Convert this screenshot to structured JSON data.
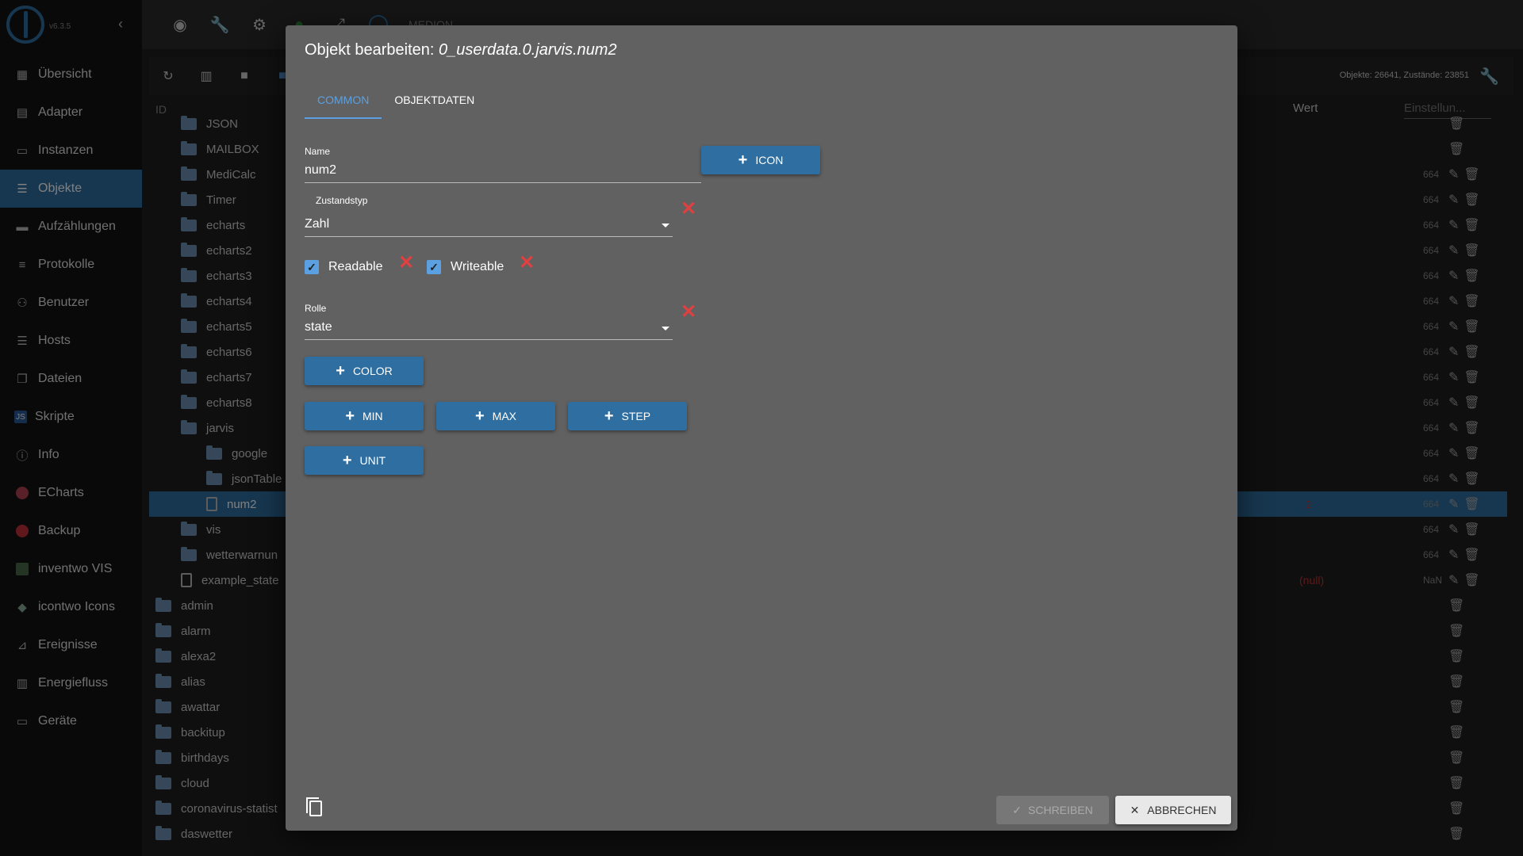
{
  "sidebar": {
    "version": "v6.3.5",
    "items": [
      {
        "label": "Übersicht",
        "icon": "grid-icon"
      },
      {
        "label": "Adapter",
        "icon": "store-icon"
      },
      {
        "label": "Instanzen",
        "icon": "instances-icon"
      },
      {
        "label": "Objekte",
        "icon": "list-icon"
      },
      {
        "label": "Aufzählungen",
        "icon": "enum-icon"
      },
      {
        "label": "Protokolle",
        "icon": "log-icon"
      },
      {
        "label": "Benutzer",
        "icon": "user-icon"
      },
      {
        "label": "Hosts",
        "icon": "hosts-icon"
      },
      {
        "label": "Dateien",
        "icon": "files-icon"
      },
      {
        "label": "Skripte",
        "icon": "js-icon"
      },
      {
        "label": "Info",
        "icon": "info-icon"
      },
      {
        "label": "ECharts",
        "icon": "echarts-icon"
      },
      {
        "label": "Backup",
        "icon": "backup-icon"
      },
      {
        "label": "inventwo VIS",
        "icon": "inventwo-icon"
      },
      {
        "label": "icontwo Icons",
        "icon": "icontwo-icon"
      },
      {
        "label": "Ereignisse",
        "icon": "events-icon"
      },
      {
        "label": "Energiefluss",
        "icon": "energy-icon"
      },
      {
        "label": "Geräte",
        "icon": "devices-icon"
      }
    ],
    "active_index": 3
  },
  "topbar": {
    "host": "MEDION"
  },
  "objects_header": {
    "counts": "Objekte: 26641, Zustände: 23851",
    "col_id": "ID",
    "col_wert": "Wert",
    "col_einstellung": "Einstellun..."
  },
  "tree": [
    {
      "name": "JSON",
      "indent": 1,
      "type": "folder"
    },
    {
      "name": "MAILBOX",
      "indent": 1,
      "type": "folder",
      "val": "",
      "acl": ""
    },
    {
      "name": "MediCalc",
      "indent": 1,
      "type": "folder",
      "acl": "664"
    },
    {
      "name": "Timer",
      "indent": 1,
      "type": "folder",
      "acl": "664"
    },
    {
      "name": "echarts",
      "indent": 1,
      "type": "folder",
      "acl": "664"
    },
    {
      "name": "echarts2",
      "indent": 1,
      "type": "folder",
      "acl": "664"
    },
    {
      "name": "echarts3",
      "indent": 1,
      "type": "folder",
      "acl": "664"
    },
    {
      "name": "echarts4",
      "indent": 1,
      "type": "folder",
      "acl": "664"
    },
    {
      "name": "echarts5",
      "indent": 1,
      "type": "folder",
      "acl": "664"
    },
    {
      "name": "echarts6",
      "indent": 1,
      "type": "folder",
      "acl": "664"
    },
    {
      "name": "echarts7",
      "indent": 1,
      "type": "folder",
      "acl": "664"
    },
    {
      "name": "echarts8",
      "indent": 1,
      "type": "folder",
      "acl": "664"
    },
    {
      "name": "jarvis",
      "indent": 1,
      "type": "folder",
      "acl": "664"
    },
    {
      "name": "google",
      "indent": 2,
      "type": "folder",
      "acl": "664"
    },
    {
      "name": "jsonTable",
      "indent": 2,
      "type": "folder",
      "acl": "664"
    },
    {
      "name": "num2",
      "indent": 2,
      "type": "file",
      "acl": "664",
      "val": "2",
      "selected": true
    },
    {
      "name": "vis",
      "indent": 1,
      "type": "folder",
      "acl": "664"
    },
    {
      "name": "wetterwarnun",
      "indent": 1,
      "type": "folder",
      "acl": "664"
    },
    {
      "name": "example_state",
      "indent": 1,
      "type": "file",
      "acl": "NaN",
      "val": "(null)"
    },
    {
      "name": "admin",
      "indent": 0,
      "type": "folder"
    },
    {
      "name": "alarm",
      "indent": 0,
      "type": "folder"
    },
    {
      "name": "alexa2",
      "indent": 0,
      "type": "folder"
    },
    {
      "name": "alias",
      "indent": 0,
      "type": "folder"
    },
    {
      "name": "awattar",
      "indent": 0,
      "type": "folder"
    },
    {
      "name": "backitup",
      "indent": 0,
      "type": "folder"
    },
    {
      "name": "birthdays",
      "indent": 0,
      "type": "folder"
    },
    {
      "name": "cloud",
      "indent": 0,
      "type": "folder"
    },
    {
      "name": "coronavirus-statist",
      "indent": 0,
      "type": "folder"
    },
    {
      "name": "daswetter",
      "indent": 0,
      "type": "folder"
    }
  ],
  "dialog": {
    "title_prefix": "Objekt bearbeiten: ",
    "title_id": "0_userdata.0.jarvis.num2",
    "tabs": [
      "COMMON",
      "OBJEKTDATEN"
    ],
    "active_tab": 0,
    "name_label": "Name",
    "name_value": "num2",
    "icon_button": "ICON",
    "type_label": "Zustandstyp",
    "type_value": "Zahl",
    "readable_label": "Readable",
    "writeable_label": "Writeable",
    "role_label": "Rolle",
    "role_value": "state",
    "color_button": "COLOR",
    "min_button": "MIN",
    "max_button": "MAX",
    "step_button": "STEP",
    "unit_button": "UNIT",
    "save_button": "SCHREIBEN",
    "cancel_button": "ABBRECHEN"
  }
}
